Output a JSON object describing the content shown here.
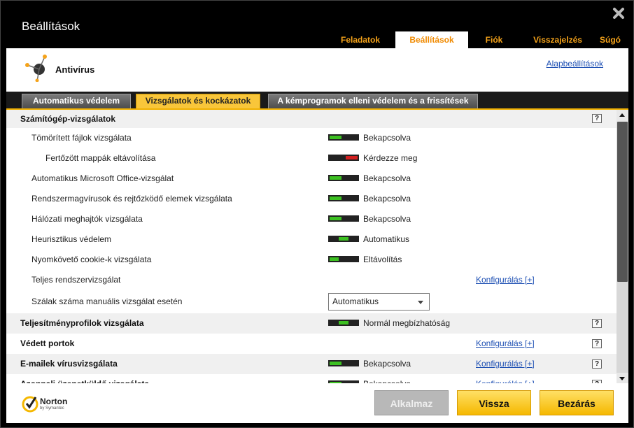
{
  "window": {
    "title": "Beállítások"
  },
  "nav": [
    {
      "label": "Feladatok"
    },
    {
      "label": "Beállítások"
    },
    {
      "label": "Fiók"
    },
    {
      "label": "Visszajelzés"
    },
    {
      "label": "Súgó"
    }
  ],
  "header": {
    "section_title": "Antivírus",
    "defaults_link": "Alapbeállítások"
  },
  "tabs": [
    {
      "label": "Automatikus védelem"
    },
    {
      "label": "Vizsgálatok és kockázatok"
    },
    {
      "label": "A kémprogramok elleni védelem és a frissítések"
    }
  ],
  "rows": [
    {
      "label": "Számítógép-vizsgálatok",
      "help": "?"
    },
    {
      "label": "Tömörített fájlok vizsgálata",
      "status": "Bekapcsolva"
    },
    {
      "label": "Fertőzött mappák eltávolítása",
      "status": "Kérdezze meg"
    },
    {
      "label": "Automatikus Microsoft Office-vizsgálat",
      "status": "Bekapcsolva"
    },
    {
      "label": "Rendszermagvírusok és rejtőzködő elemek vizsgálata",
      "status": "Bekapcsolva"
    },
    {
      "label": "Hálózati meghajtók vizsgálata",
      "status": "Bekapcsolva"
    },
    {
      "label": "Heurisztikus védelem",
      "status": "Automatikus"
    },
    {
      "label": "Nyomkövető cookie-k vizsgálata",
      "status": "Eltávolítás"
    },
    {
      "label": "Teljes rendszervizsgálat",
      "link": "Konfigurálás [+]"
    },
    {
      "label": "Szálak száma manuális vizsgálat esetén",
      "select_value": "Automatikus"
    },
    {
      "label": "Teljesítményprofilok vizsgálata",
      "status": "Normál megbízhatóság",
      "help": "?"
    },
    {
      "label": "Védett portok",
      "link": "Konfigurálás [+]",
      "help": "?"
    },
    {
      "label": "E-mailek vírusvizsgálata",
      "status": "Bekapcsolva",
      "link": "Konfigurálás [+]",
      "help": "?"
    },
    {
      "label": "Azonnali üzenetküldő vizsgálata",
      "status": "Bekapcsolva",
      "link": "Konfigurálás [+]",
      "help": "?"
    }
  ],
  "colors": {
    "accent": "#f5a31a",
    "toggle_on": "#3cc021",
    "toggle_ask": "#d42020",
    "link": "#1d4fb3"
  },
  "footer": {
    "brand": "Norton",
    "brand_sub": "by Symantec",
    "apply_label": "Alkalmaz",
    "back_label": "Vissza",
    "close_label": "Bezárás"
  }
}
